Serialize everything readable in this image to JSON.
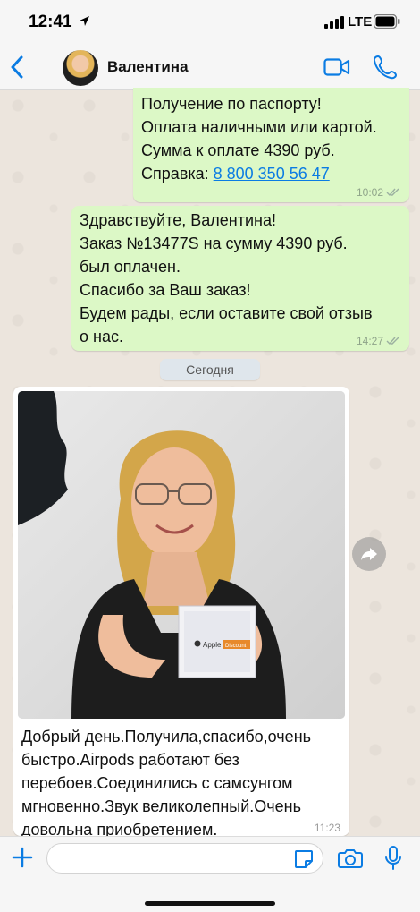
{
  "status_bar": {
    "time": "12:41",
    "network": "LTE"
  },
  "header": {
    "contact_name": "Валентина"
  },
  "messages": [
    {
      "text": "Получение по паспорту!\nОплата наличными или картой.\nСумма к оплате 4390 руб.\nСправка: ",
      "link": "8 800 350 56 47",
      "time": "10:02"
    },
    {
      "text": "Здравствуйте, Валентина!\nЗаказ №13477S на сумму 4390 руб.\nбыл оплачен.\nСпасибо за Ваш заказ!\nБудем рады, если оставите свой отзыв\nо нас.",
      "time": "14:27"
    }
  ],
  "date_separator": "Сегодня",
  "photo_message": {
    "box_label": "Apple",
    "box_badge": "Discount",
    "caption": "Добрый день.Получила,спасибо,очень\nбыстро.Airpods работают без\nперебоев.Соединились с самсунгом\nмгновенно.Звук великолепный.Очень\nдовольна приобретением.",
    "time": "11:23"
  },
  "input": {
    "placeholder": ""
  },
  "colors": {
    "accent": "#0b7ce3",
    "outgoing_bubble": "#dcf8c6",
    "incoming_bubble": "#ffffff",
    "wallpaper": "#ece5dd"
  },
  "icons": [
    "back-chevron-icon",
    "video-call-icon",
    "phone-icon",
    "share-icon",
    "plus-icon",
    "sticker-icon",
    "camera-icon",
    "microphone-icon",
    "double-check-icon"
  ]
}
